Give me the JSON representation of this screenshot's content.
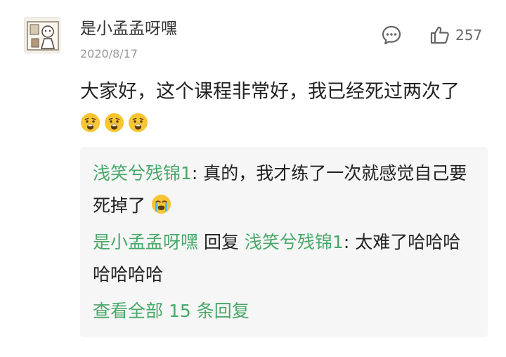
{
  "comment": {
    "author": "是小孟孟呀嘿",
    "date": "2020/8/17",
    "text": "大家好，这个课程非常好，我已经死过两次了",
    "emojis": [
      "anguished-face-icon",
      "anguished-face-icon",
      "anguished-face-icon"
    ],
    "reply_icon": "comment-bubble-icon",
    "like_icon": "thumbs-up-icon",
    "like_count": "257"
  },
  "replies": [
    {
      "author": "浅笑兮残锦1",
      "separator": ": ",
      "text": "真的，我才练了一次就感觉自己要死掉了",
      "emoji": "crying-face-icon"
    },
    {
      "author": "是小孟孟呀嘿",
      "reply_word": " 回复 ",
      "target": "浅笑兮残锦1",
      "separator": ": ",
      "text": "太难了哈哈哈哈哈哈哈"
    }
  ],
  "view_all_label": "查看全部 15 条回复",
  "colors": {
    "link_green": "#48a869",
    "date_gray": "#9a9a9a",
    "reply_background": "#f6f6f6",
    "emoji_yellow": "#f7c531"
  }
}
